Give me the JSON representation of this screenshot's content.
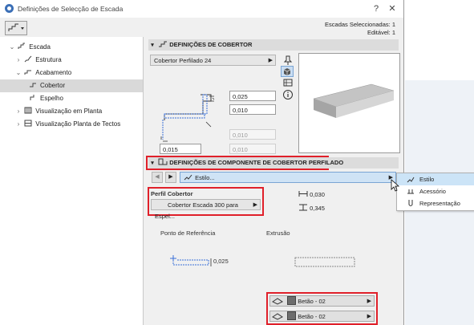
{
  "window": {
    "title": "Definições de Selecção de Escada"
  },
  "selection_info": {
    "selected": "Escadas Seleccionadas: 1",
    "editable": "Editável: 1"
  },
  "tree": {
    "root": "Escada",
    "structure": "Estrutura",
    "finish": "Acabamento",
    "tread": "Cobertor",
    "riser": "Espelho",
    "floor_plan": "Visualização em Planta",
    "ceiling_plan": "Visualização Planta de Tectos"
  },
  "tread_settings": {
    "header": "DEFINIÇÕES DE COBERTOR",
    "type": "Cobertor Perfilado 24",
    "field1": "0,025",
    "field2": "0,010",
    "field3": "0,010",
    "field4": "0,015",
    "field5": "0,010"
  },
  "component_settings": {
    "header": "DEFINIÇÕES DE COMPONENTE DE COBERTOR PERFILADO",
    "style_dropdown": "Estilo...",
    "dimension1": "0,030",
    "dimension2": "0,345",
    "profile_label": "Perfil Cobertor",
    "profile_value": "Cobertor Escada 300 para Espel...",
    "reference_point": "Ponto de Referência",
    "extrusion": "Extrusão",
    "ref_value": "0,025",
    "material1": "Betão - 02",
    "material2": "Betão - 02"
  },
  "popup": {
    "items": [
      "Estilo",
      "Acessório",
      "Representação"
    ]
  }
}
